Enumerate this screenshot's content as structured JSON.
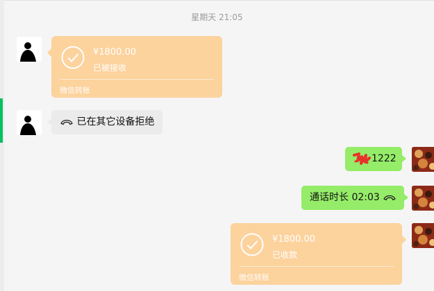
{
  "timestamp": "星期天 21:05",
  "messages": [
    {
      "type": "transfer",
      "direction": "incoming",
      "amount": "¥1800.00",
      "status": "已被接收",
      "footer": "微信转账"
    },
    {
      "type": "call",
      "direction": "incoming",
      "text": "已在其它设备拒绝",
      "icon": "phone-hangup-icon"
    },
    {
      "type": "text",
      "direction": "outgoing",
      "text": "1222",
      "sticker": "red-scribble-icon"
    },
    {
      "type": "call",
      "direction": "outgoing",
      "text": "通话时长 02:03",
      "icon": "phone-hangup-icon"
    },
    {
      "type": "transfer",
      "direction": "outgoing",
      "amount": "¥1800.00",
      "status": "已收款",
      "footer": "微信转账"
    }
  ],
  "colors": {
    "transfer_bg": "#fcd29d",
    "outgoing_bubble": "#95ec69",
    "incoming_bubble": "#ebebeb",
    "accent": "#07c160",
    "background": "#f5f5f5"
  }
}
